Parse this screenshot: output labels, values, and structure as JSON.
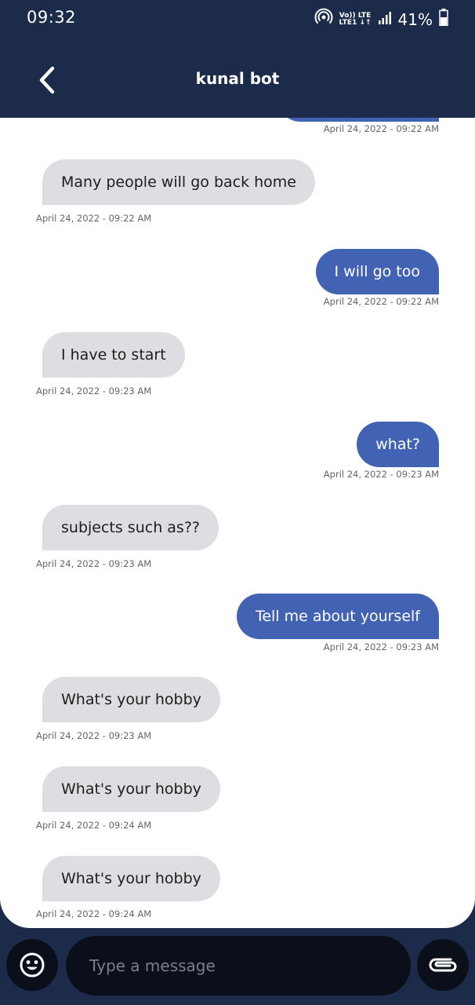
{
  "status": {
    "time": "09:32",
    "network_top": "Vo)) LTE",
    "network_bottom": "LTE1 ↓↑",
    "battery": "41%"
  },
  "header": {
    "title": "kunal bot"
  },
  "messages": [
    {
      "sender": "user",
      "text": "",
      "timestamp": "April 24, 2022 - 09:22 AM"
    },
    {
      "sender": "bot",
      "text": "Many people will go back home",
      "timestamp": "April 24, 2022 - 09:22 AM"
    },
    {
      "sender": "user",
      "text": "I will go too",
      "timestamp": "April 24, 2022 - 09:22 AM"
    },
    {
      "sender": "bot",
      "text": "I have to start",
      "timestamp": "April 24, 2022 - 09:23 AM"
    },
    {
      "sender": "user",
      "text": "what?",
      "timestamp": "April 24, 2022 - 09:23 AM"
    },
    {
      "sender": "bot",
      "text": "subjects such as??",
      "timestamp": "April 24, 2022 - 09:23 AM"
    },
    {
      "sender": "user",
      "text": "Tell me about yourself",
      "timestamp": "April 24, 2022 - 09:23 AM"
    },
    {
      "sender": "bot",
      "text": "What's your hobby",
      "timestamp": "April 24, 2022 - 09:23 AM"
    },
    {
      "sender": "bot",
      "text": "What's your hobby",
      "timestamp": "April 24, 2022 - 09:24 AM"
    },
    {
      "sender": "bot",
      "text": "What's your hobby",
      "timestamp": "April 24, 2022 - 09:24 AM"
    }
  ],
  "composer": {
    "placeholder": "Type a message",
    "value": ""
  },
  "colors": {
    "header_bg": "#1c2b4a",
    "user_bubble": "#4262b3",
    "bot_bubble": "#dddee2",
    "button_bg": "#0b0f1a"
  }
}
